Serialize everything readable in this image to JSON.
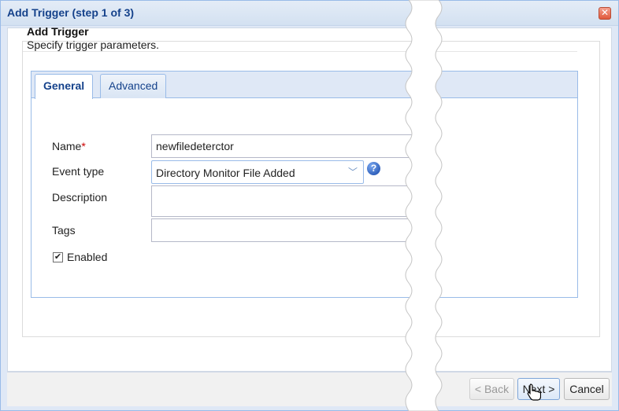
{
  "dialog": {
    "title": "Add Trigger (step 1 of 3)",
    "close_glyph": "✕"
  },
  "header": {
    "title": "Add Trigger",
    "subtitle": "Specify trigger parameters."
  },
  "tabs": [
    {
      "label": "General",
      "active": true
    },
    {
      "label": "Advanced",
      "active": false
    }
  ],
  "form": {
    "name": {
      "label": "Name",
      "required_marker": "*",
      "value": "newfiledeterctor"
    },
    "event_type": {
      "label": "Event type",
      "value": "Directory Monitor File Added",
      "help_glyph": "?"
    },
    "description": {
      "label": "Description",
      "value": ""
    },
    "tags": {
      "label": "Tags",
      "value": ""
    },
    "enabled": {
      "label": "Enabled",
      "checked": true,
      "check_glyph": "✔"
    }
  },
  "footer": {
    "back_label": "< Back",
    "next_label": "Next >",
    "cancel_label": "Cancel"
  },
  "colors": {
    "title_text": "#15428b",
    "frame_border": "#99bbe8",
    "tab_strip": "#dfe8f6",
    "required": "#cc0000"
  }
}
